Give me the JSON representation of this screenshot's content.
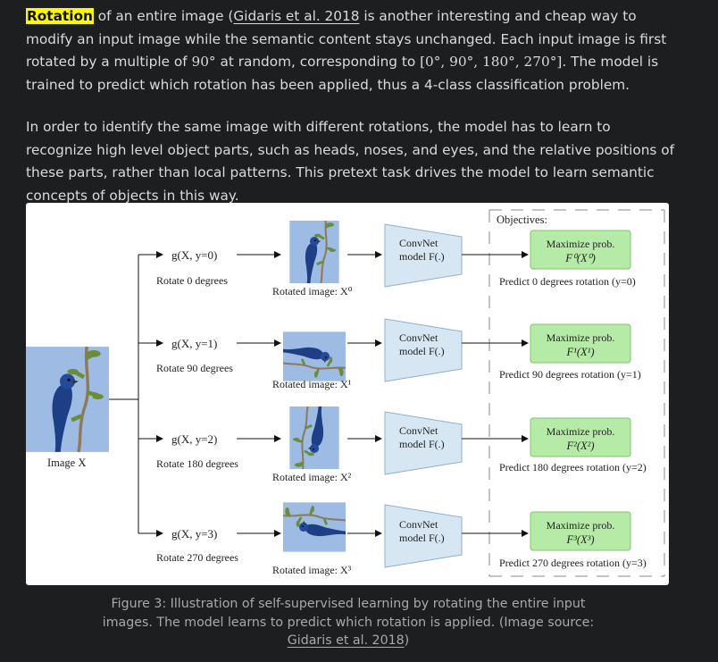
{
  "paragraph1": {
    "highlight": "Rotation",
    "text_a": " of an entire image (",
    "link": "Gidaris et al. 2018",
    "text_b": " is another interesting and cheap way to modify an input image while the semantic content stays unchanged. Each input image is first rotated by a multiple of ",
    "angle": "90°",
    "text_c": " at random, corresponding to ",
    "set": "[0°, 90°, 180°, 270°]",
    "text_d": ". The model is trained to predict which rotation has been applied, thus a 4-class classification problem."
  },
  "paragraph2": "In order to identify the same image with different rotations, the model has to learn to recognize high level object parts, such as heads, noses, and eyes, and the relative positions of these parts, rather than local patterns. This pretext task drives the model to learn semantic concepts of objects in this way.",
  "figure": {
    "input_label": "Image X",
    "objectives_title": "Objectives:",
    "rows": [
      {
        "g": "g(X, y=0)",
        "rotate": "Rotate 0 degrees",
        "rotated": "Rotated image: X⁰",
        "model_1": "ConvNet",
        "model_2": "model F(.)",
        "obj_1": "Maximize prob.",
        "obj_2": "F⁰(X⁰)",
        "predict": "Predict 0 degrees rotation (y=0)"
      },
      {
        "g": "g(X, y=1)",
        "rotate": "Rotate 90 degrees",
        "rotated": "Rotated image: X¹",
        "model_1": "ConvNet",
        "model_2": "model F(.)",
        "obj_1": "Maximize prob.",
        "obj_2": "F¹(X¹)",
        "predict": "Predict 90 degrees rotation (y=1)"
      },
      {
        "g": "g(X, y=2)",
        "rotate": "Rotate 180 degrees",
        "rotated": "Rotated image: X²",
        "model_1": "ConvNet",
        "model_2": "model F(.)",
        "obj_1": "Maximize prob.",
        "obj_2": "F²(X²)",
        "predict": "Predict 180 degrees rotation (y=2)"
      },
      {
        "g": "g(X, y=3)",
        "rotate": "Rotate 270 degrees",
        "rotated": "Rotated image: X³",
        "model_1": "ConvNet",
        "model_2": "model F(.)",
        "obj_1": "Maximize prob.",
        "obj_2": "F³(X³)",
        "predict": "Predict 270 degrees rotation (y=3)"
      }
    ]
  },
  "caption": {
    "text": "Figure 3: Illustration of self-supervised learning by rotating the entire input images. The model learns to predict which rotation is applied. (Image source: ",
    "link": "Gidaris et al. 2018",
    "end": ")"
  },
  "colors": {
    "background": "#1d1e20",
    "text": "#dadadb",
    "highlight": "#fff700",
    "caption": "#a8a9ad",
    "photo_sky": "#9dbbe3",
    "convnet_fill": "#d6e6f3",
    "objective_fill": "#b5eba6"
  }
}
